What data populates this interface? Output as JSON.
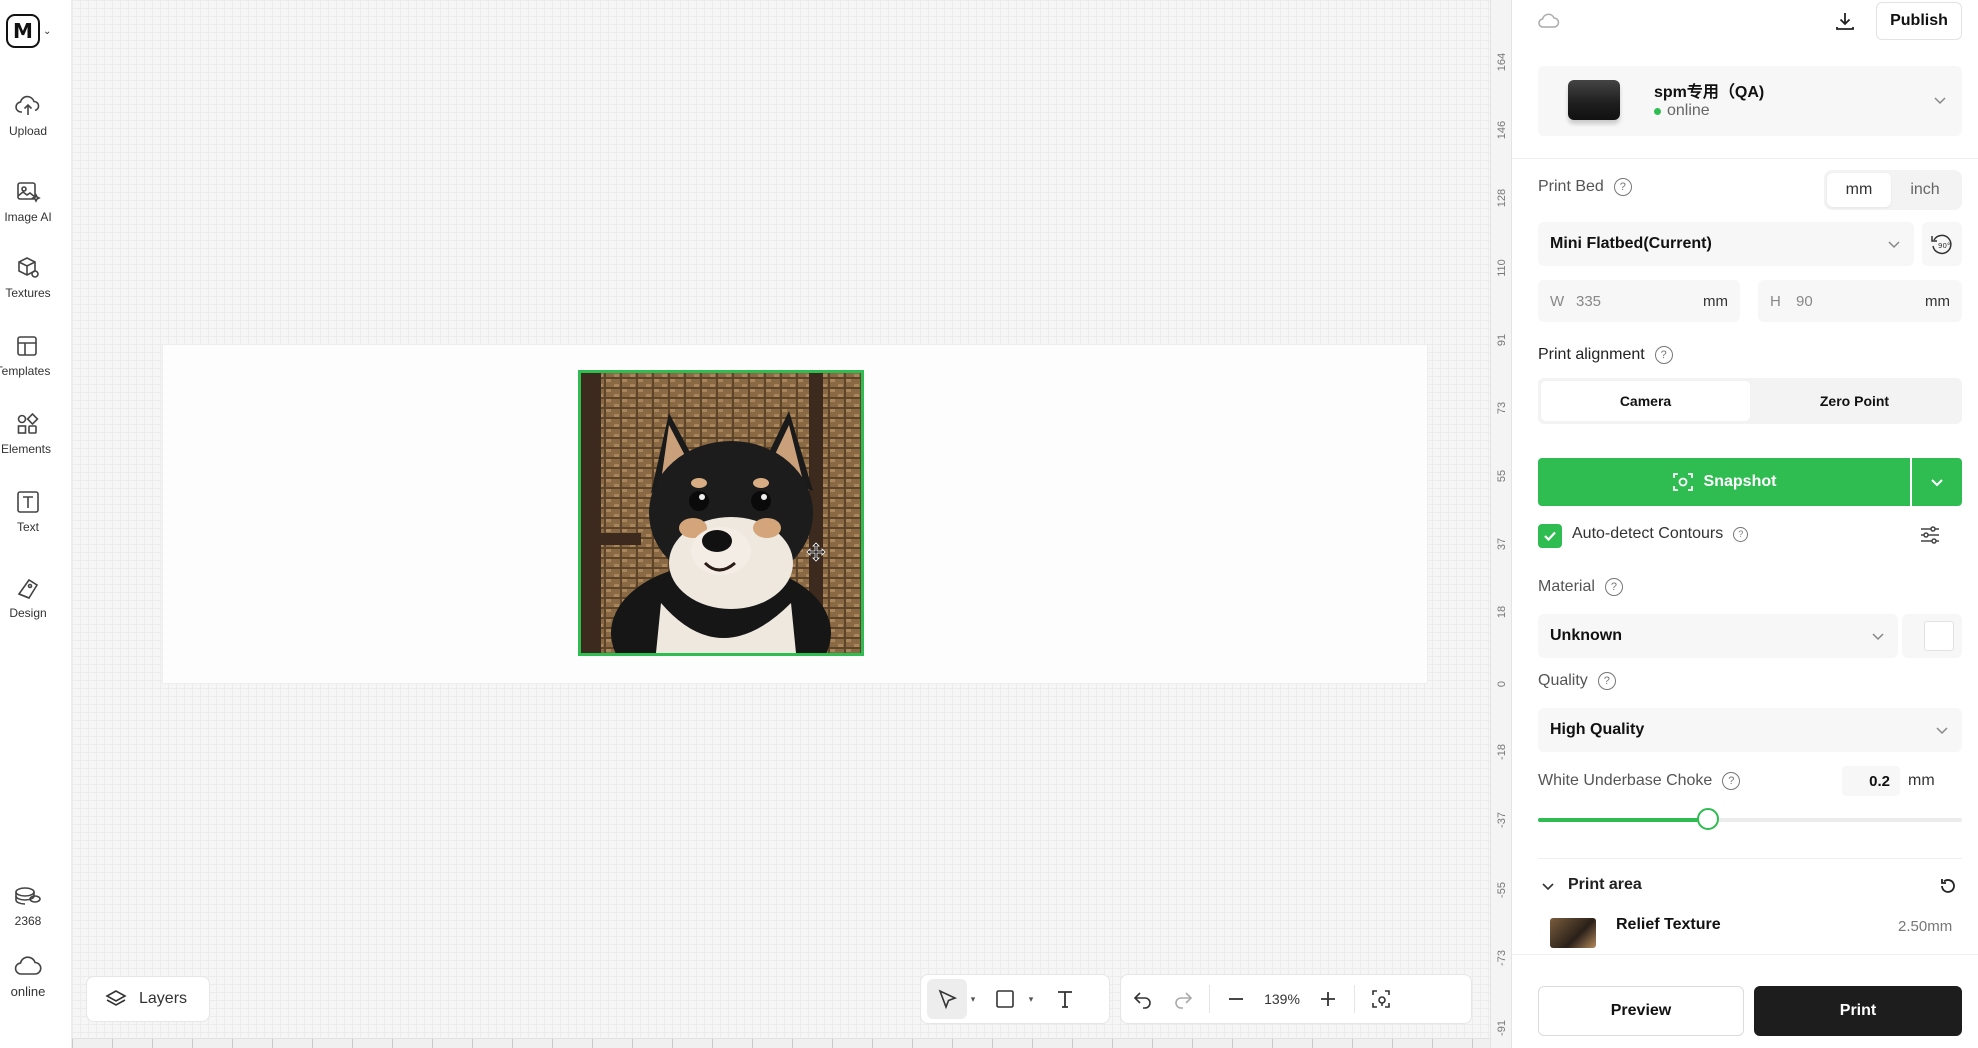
{
  "sidebar": {
    "logo_letter": "M",
    "items": [
      {
        "label": "Upload",
        "icon": "cloud-upload-icon"
      },
      {
        "label": "Image AI",
        "icon": "image-ai-icon"
      },
      {
        "label": "Textures",
        "icon": "textures-icon"
      },
      {
        "label": "Templates",
        "icon": "templates-icon"
      },
      {
        "label": "Elements",
        "icon": "elements-icon"
      },
      {
        "label": "Text",
        "icon": "text-icon"
      },
      {
        "label": "Design",
        "icon": "design-icon"
      }
    ],
    "credits": "2368",
    "status": "online"
  },
  "canvas": {
    "layers_label": "Layers",
    "zoom": "139%",
    "ruler_ticks": [
      "164",
      "146",
      "128",
      "110",
      "91",
      "73",
      "55",
      "37",
      "18",
      "0",
      "-18",
      "-37",
      "-55",
      "-73",
      "-91"
    ]
  },
  "panel": {
    "publish_label": "Publish",
    "device": {
      "name": "spm专用（QA)",
      "status": "online"
    },
    "print_bed": {
      "label": "Print Bed",
      "units": [
        "mm",
        "inch"
      ],
      "selected_unit": "mm",
      "bed_select": "Mini Flatbed(Current)",
      "width_key": "W",
      "width": "335",
      "width_unit": "mm",
      "height_key": "H",
      "height": "90",
      "height_unit": "mm"
    },
    "alignment": {
      "label": "Print alignment",
      "options": [
        "Camera",
        "Zero Point"
      ],
      "selected": "Camera"
    },
    "snapshot_label": "Snapshot",
    "auto_detect_label": "Auto-detect Contours",
    "auto_detect_checked": true,
    "material": {
      "label": "Material",
      "value": "Unknown"
    },
    "quality": {
      "label": "Quality",
      "value": "High Quality"
    },
    "choke": {
      "label": "White Underbase Choke",
      "value": "0.2",
      "unit": "mm",
      "slider_fraction": 0.4
    },
    "print_area": {
      "label": "Print area",
      "item_name": "Relief Texture",
      "item_value": "2.50mm"
    },
    "preview_label": "Preview",
    "print_label": "Print"
  },
  "colors": {
    "accent": "#2fbd52",
    "dark": "#1d1d1d"
  }
}
